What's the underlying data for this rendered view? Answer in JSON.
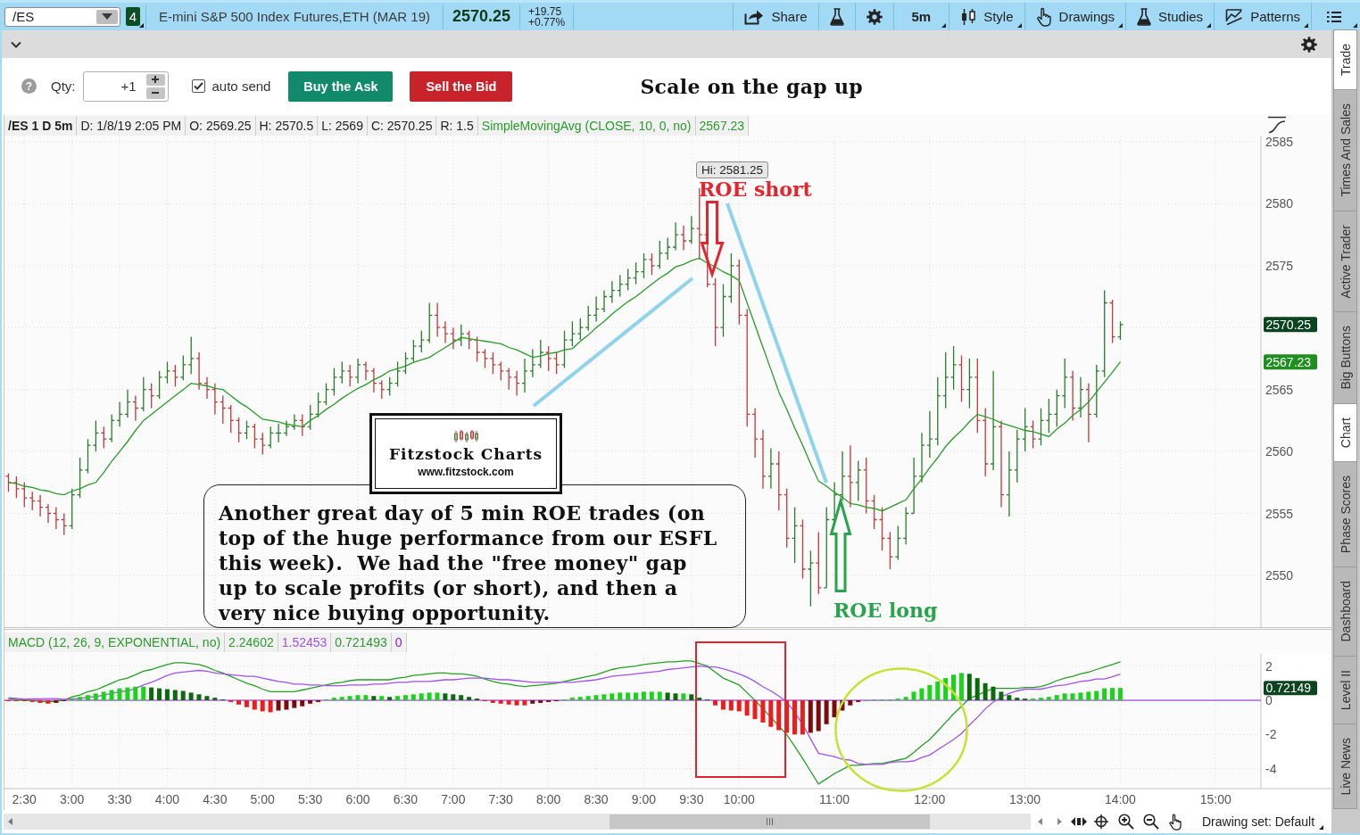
{
  "toolbar": {
    "symbol": "/ES",
    "link_badge": "4",
    "description": "E-mini S&P 500 Index Futures,ETH (MAR 19)",
    "last_price": "2570.25",
    "net_change": "+19.75",
    "percent_change": "+0.77%",
    "buttons": [
      {
        "kind": "share",
        "label": "Share",
        "dropdown": false
      },
      {
        "kind": "flask",
        "dropdown": false
      },
      {
        "kind": "gear",
        "dropdown": false
      },
      {
        "kind": "text",
        "label": "5m",
        "dropdown": true
      },
      {
        "kind": "style",
        "label": "Style",
        "dropdown": true
      },
      {
        "kind": "drawings",
        "label": "Drawings",
        "dropdown": true
      },
      {
        "kind": "studies",
        "label": "Studies",
        "dropdown": true
      },
      {
        "kind": "patterns",
        "label": "Patterns",
        "dropdown": true
      },
      {
        "kind": "menu",
        "dropdown": true
      }
    ]
  },
  "order_bar": {
    "help": "?",
    "qty_label": "Qty:",
    "qty": "+1",
    "auto_send": {
      "label": "auto send",
      "checked": true
    },
    "buttons": [
      {
        "kind": "buy",
        "label": "Buy the Ask"
      },
      {
        "kind": "sell",
        "label": "Sell the Bid"
      }
    ],
    "headline": "Scale on the gap up"
  },
  "price_panel": {
    "header": [
      {
        "kind": "symbol",
        "text": "/ES 1 D 5m"
      },
      {
        "kind": "field",
        "text": "D: 1/8/19 2:05 PM"
      },
      {
        "kind": "field",
        "text": "O: 2569.25"
      },
      {
        "kind": "field",
        "text": "H: 2570.5"
      },
      {
        "kind": "field",
        "text": "L: 2569"
      },
      {
        "kind": "field",
        "text": "C: 2570.25"
      },
      {
        "kind": "field",
        "text": "R: 1.5"
      },
      {
        "kind": "study",
        "text": "SimpleMovingAvg (CLOSE, 10, 0, no)"
      },
      {
        "kind": "study",
        "text": "2567.23"
      }
    ],
    "axis_labels": [
      "2585",
      "2580",
      "2575",
      "2565",
      "2560",
      "2555",
      "2550"
    ],
    "tags": [
      {
        "kind": "close",
        "text": "2570.25",
        "color": "#0c4420"
      },
      {
        "kind": "study",
        "text": "2567.23",
        "color": "#1f8f1f"
      }
    ],
    "drawings": [
      {
        "kind": "callout",
        "text": "Hi: 2581.25"
      },
      {
        "kind": "label",
        "text": "ROE short",
        "color": "#e3262d"
      },
      {
        "kind": "arrow-down",
        "color": "#e3262d"
      },
      {
        "kind": "trendline",
        "color": "#8fd4ec"
      },
      {
        "kind": "trendline",
        "color": "#8fd4ec"
      },
      {
        "kind": "logo",
        "title": "Fitzstock Charts",
        "subtitle": "www.fitzstock.com"
      },
      {
        "kind": "note",
        "text": "Another great day of 5 min ROE trades (on\ntop of the huge performance from our ESFL\nthis week).  We had the \"free money\" gap\nup to scale profits (or short), and then a\nvery nice buying opportunity."
      },
      {
        "kind": "arrow-up",
        "color": "#2aa44c"
      },
      {
        "kind": "label",
        "text": "ROE long",
        "color": "#2aa44c"
      }
    ]
  },
  "macd_panel": {
    "header": [
      {
        "text": "MACD (12, 26, 9, EXPONENTIAL, no)",
        "color": "#2b9b2b"
      },
      {
        "text": "2.24602",
        "color": "#2b9b2b"
      },
      {
        "text": "1.52453",
        "color": "#a352ec"
      },
      {
        "text": "0.721493",
        "color": "#2b9b2b"
      },
      {
        "text": "0",
        "color": "#8a1ccf"
      }
    ],
    "tags": [
      {
        "kind": "diff",
        "text": "0.72149",
        "color": "#0c4420"
      }
    ],
    "chart_data": {
      "type": "line",
      "grid": true,
      "xlim": [
        137.5,
        972.9
      ],
      "ylim": [
        -5.17,
        2.715
      ],
      "yticks": [
        {
          "value": 2,
          "label": "2"
        },
        {
          "value": 0,
          "label": "0"
        },
        {
          "value": -2,
          "label": "-2"
        },
        {
          "value": -4,
          "label": "-4"
        }
      ],
      "xticks": [
        {
          "value": 150,
          "label": "2:30"
        },
        {
          "value": 180,
          "label": "3:00"
        },
        {
          "value": 210,
          "label": "3:30"
        },
        {
          "value": 240,
          "label": "4:00"
        },
        {
          "value": 270,
          "label": "4:30"
        },
        {
          "value": 300,
          "label": "5:00"
        },
        {
          "value": 330,
          "label": "5:30"
        },
        {
          "value": 360,
          "label": "6:00"
        },
        {
          "value": 390,
          "label": "6:30"
        },
        {
          "value": 420,
          "label": "7:00"
        },
        {
          "value": 450,
          "label": "7:30"
        },
        {
          "value": 480,
          "label": "8:00"
        },
        {
          "value": 510,
          "label": "8:30"
        },
        {
          "value": 540,
          "label": "9:00"
        },
        {
          "value": 570,
          "label": "9:30"
        },
        {
          "value": 600,
          "label": "10:00"
        },
        {
          "value": 660,
          "label": "11:00"
        },
        {
          "value": 720,
          "label": "12:00"
        },
        {
          "value": 780,
          "label": "13:00"
        },
        {
          "value": 840,
          "label": "14:00"
        },
        {
          "value": 900,
          "label": "15:00"
        }
      ],
      "ref_lines": [
        {
          "axis": "y",
          "value": 0,
          "color": "#8a1ccf"
        }
      ],
      "x": [
        140,
        145,
        150,
        155,
        160,
        165,
        170,
        175,
        180,
        185,
        190,
        195,
        200,
        205,
        210,
        215,
        220,
        225,
        230,
        235,
        240,
        245,
        250,
        255,
        260,
        265,
        270,
        275,
        280,
        285,
        290,
        295,
        300,
        305,
        310,
        315,
        320,
        325,
        330,
        335,
        340,
        345,
        350,
        355,
        360,
        365,
        370,
        375,
        380,
        385,
        390,
        395,
        400,
        405,
        410,
        415,
        420,
        425,
        430,
        435,
        440,
        445,
        450,
        455,
        460,
        465,
        470,
        475,
        480,
        485,
        490,
        495,
        500,
        505,
        510,
        515,
        520,
        525,
        530,
        535,
        540,
        545,
        550,
        555,
        560,
        565,
        570,
        575,
        580,
        585,
        590,
        595,
        600,
        605,
        610,
        615,
        620,
        625,
        630,
        635,
        640,
        645,
        650,
        655,
        660,
        665,
        670,
        675,
        680,
        685,
        690,
        695,
        700,
        705,
        710,
        715,
        720,
        725,
        730,
        735,
        740,
        745,
        750,
        755,
        760,
        765,
        770,
        775,
        780,
        785,
        790,
        795,
        800,
        805,
        810,
        815,
        820,
        825,
        830,
        835,
        840
      ],
      "series": [
        {
          "color": "#25a025",
          "values": [
            0.1,
            0.06,
            0.02,
            -0.02,
            -0.06,
            -0.1,
            -0.05,
            0,
            0.2,
            0.3,
            0.5,
            0.6,
            0.8,
            1.0,
            1.2,
            1.3,
            1.5,
            1.7,
            1.8,
            1.95,
            2.1,
            2.2,
            2.2,
            2.15,
            2.1,
            1.95,
            1.75,
            1.6,
            1.4,
            1.2,
            1.0,
            0.85,
            0.65,
            0.5,
            0.5,
            0.5,
            0.5,
            0.6,
            0.7,
            0.8,
            0.9,
            1.0,
            1.05,
            1.15,
            1.2,
            1.2,
            1.2,
            1.2,
            1.2,
            1.3,
            1.35,
            1.45,
            1.5,
            1.55,
            1.6,
            1.6,
            1.55,
            1.55,
            1.5,
            1.4,
            1.25,
            1.1,
            1.0,
            0.95,
            0.85,
            0.8,
            0.85,
            0.9,
            0.95,
            1.0,
            1.1,
            1.2,
            1.3,
            1.4,
            1.5,
            1.65,
            1.8,
            1.9,
            1.95,
            2.0,
            2.1,
            2.15,
            2.2,
            2.25,
            2.25,
            2.3,
            2.3,
            2.15,
            2.0,
            1.65,
            1.3,
            1.1,
            0.9,
            0.45,
            0,
            -0.5,
            -1.0,
            -1.5,
            -2.0,
            -2.7,
            -3.4,
            -4.15,
            -4.9,
            -4.6,
            -4.3,
            -4.05,
            -3.8,
            -3.8,
            -3.75,
            -3.7,
            -3.7,
            -3.6,
            -3.5,
            -3.4,
            -3.05,
            -2.65,
            -2.3,
            -1.8,
            -1.3,
            -0.8,
            -0.35,
            0.1,
            0.3,
            0.5,
            0.7,
            0.7,
            0.7,
            0.7,
            0.75,
            0.75,
            0.8,
            0.95,
            1.15,
            1.3,
            1.4,
            1.55,
            1.65,
            1.8,
            1.95,
            2.1,
            2.25
          ]
        },
        {
          "color": "#a352ec",
          "values": [
            0.15,
            0.11,
            0.07,
            0.08,
            0.09,
            0.1,
            0.1,
            0.05,
            0.1,
            0.1,
            0.2,
            0.2,
            0.3,
            0.4,
            0.5,
            0.55,
            0.7,
            0.9,
            1.05,
            1.25,
            1.45,
            1.6,
            1.65,
            1.7,
            1.75,
            1.7,
            1.6,
            1.55,
            1.5,
            1.45,
            1.4,
            1.4,
            1.3,
            1.2,
            1.1,
            1.05,
            0.95,
            0.95,
            0.9,
            0.9,
            0.85,
            0.85,
            0.85,
            0.9,
            0.9,
            0.9,
            0.95,
            0.95,
            1.0,
            1.05,
            1.05,
            1.1,
            1.1,
            1.1,
            1.15,
            1.2,
            1.2,
            1.25,
            1.3,
            1.3,
            1.3,
            1.25,
            1.2,
            1.2,
            1.15,
            1.1,
            1.05,
            1.05,
            1.05,
            1.05,
            1.05,
            1.05,
            1.1,
            1.15,
            1.2,
            1.3,
            1.4,
            1.45,
            1.5,
            1.55,
            1.6,
            1.65,
            1.7,
            1.8,
            1.85,
            1.9,
            1.95,
            2.0,
            1.95,
            1.95,
            1.85,
            1.7,
            1.55,
            1.35,
            1.1,
            0.8,
            0.55,
            0.25,
            -0.1,
            -0.7,
            -1.4,
            -2.25,
            -3.1,
            -3.2,
            -3.3,
            -3.45,
            -3.5,
            -3.7,
            -3.75,
            -3.75,
            -3.75,
            -3.65,
            -3.6,
            -3.6,
            -3.55,
            -3.35,
            -3.2,
            -2.9,
            -2.6,
            -2.3,
            -1.95,
            -1.45,
            -1.0,
            -0.5,
            -0.1,
            0.2,
            0.4,
            0.55,
            0.65,
            0.65,
            0.65,
            0.75,
            0.85,
            0.9,
            1.0,
            1.1,
            1.15,
            1.25,
            1.25,
            1.38,
            1.53
          ]
        },
        {
          "type": "bar",
          "values": [
            -0.05,
            -0.05,
            -0.05,
            -0.1,
            -0.15,
            -0.2,
            -0.15,
            -0.05,
            0.1,
            0.2,
            0.3,
            0.4,
            0.5,
            0.6,
            0.7,
            0.75,
            0.8,
            0.8,
            0.75,
            0.7,
            0.65,
            0.6,
            0.55,
            0.45,
            0.35,
            0.25,
            0.15,
            0.05,
            -0.1,
            -0.25,
            -0.4,
            -0.55,
            -0.65,
            -0.7,
            -0.6,
            -0.55,
            -0.45,
            -0.35,
            -0.2,
            -0.1,
            0.05,
            0.15,
            0.2,
            0.25,
            0.3,
            0.3,
            0.25,
            0.25,
            0.2,
            0.25,
            0.3,
            0.35,
            0.4,
            0.45,
            0.45,
            0.4,
            0.35,
            0.3,
            0.2,
            0.1,
            -0.05,
            -0.15,
            -0.2,
            -0.25,
            -0.3,
            -0.3,
            -0.2,
            -0.15,
            -0.1,
            -0.05,
            0.05,
            0.15,
            0.2,
            0.25,
            0.3,
            0.35,
            0.4,
            0.45,
            0.45,
            0.45,
            0.5,
            0.5,
            0.5,
            0.45,
            0.4,
            0.4,
            0.35,
            0.15,
            0.05,
            -0.3,
            -0.55,
            -0.6,
            -0.65,
            -0.9,
            -1.1,
            -1.3,
            -1.55,
            -1.75,
            -1.9,
            -2.0,
            -2.0,
            -1.9,
            -1.8,
            -1.4,
            -1.0,
            -0.6,
            -0.3,
            -0.1,
            0,
            0.05,
            0.05,
            0.05,
            0.1,
            0.2,
            0.5,
            0.7,
            0.9,
            1.1,
            1.3,
            1.5,
            1.6,
            1.55,
            1.3,
            1.0,
            0.8,
            0.5,
            0.3,
            0.15,
            0.1,
            0.1,
            0.15,
            0.2,
            0.3,
            0.4,
            0.4,
            0.45,
            0.5,
            0.55,
            0.7,
            0.72,
            0.72
          ],
          "colors": [
            "#ee1c1c",
            "#ee1c1c",
            "#ee1c1c",
            "#ee1c1c",
            "#ee1c1c",
            "#ee1c1c",
            "#7c0b0b",
            "#7c0b0b",
            "#19d419",
            "#19d419",
            "#19d419",
            "#19d419",
            "#19d419",
            "#19d419",
            "#19d419",
            "#19d419",
            "#19d419",
            "#19d419",
            "#0b6a0b",
            "#0b6a0b",
            "#0b6a0b",
            "#0b6a0b",
            "#0b6a0b",
            "#0b6a0b",
            "#0b6a0b",
            "#0b6a0b",
            "#0b6a0b",
            "#0b6a0b",
            "#ee1c1c",
            "#ee1c1c",
            "#ee1c1c",
            "#ee1c1c",
            "#ee1c1c",
            "#ee1c1c",
            "#7c0b0b",
            "#7c0b0b",
            "#7c0b0b",
            "#7c0b0b",
            "#7c0b0b",
            "#7c0b0b",
            "#19d419",
            "#19d419",
            "#19d419",
            "#19d419",
            "#19d419",
            "#19d419",
            "#0b6a0b",
            "#19d419",
            "#0b6a0b",
            "#19d419",
            "#19d419",
            "#19d419",
            "#19d419",
            "#19d419",
            "#19d419",
            "#0b6a0b",
            "#0b6a0b",
            "#0b6a0b",
            "#0b6a0b",
            "#0b6a0b",
            "#ee1c1c",
            "#ee1c1c",
            "#ee1c1c",
            "#ee1c1c",
            "#ee1c1c",
            "#ee1c1c",
            "#7c0b0b",
            "#7c0b0b",
            "#7c0b0b",
            "#7c0b0b",
            "#19d419",
            "#19d419",
            "#19d419",
            "#19d419",
            "#19d419",
            "#19d419",
            "#19d419",
            "#19d419",
            "#19d419",
            "#19d419",
            "#19d419",
            "#19d419",
            "#19d419",
            "#0b6a0b",
            "#0b6a0b",
            "#19d419",
            "#0b6a0b",
            "#0b6a0b",
            "#0b6a0b",
            "#ee1c1c",
            "#ee1c1c",
            "#ee1c1c",
            "#ee1c1c",
            "#ee1c1c",
            "#ee1c1c",
            "#ee1c1c",
            "#ee1c1c",
            "#ee1c1c",
            "#ee1c1c",
            "#ee1c1c",
            "#ee1c1c",
            "#7c0b0b",
            "#7c0b0b",
            "#7c0b0b",
            "#7c0b0b",
            "#7c0b0b",
            "#7c0b0b",
            "#7c0b0b",
            "#19d419",
            "#19d419",
            "#19d419",
            "#19d419",
            "#19d419",
            "#19d419",
            "#19d419",
            "#19d419",
            "#19d419",
            "#19d419",
            "#19d419",
            "#19d419",
            "#19d419",
            "#0b6a0b",
            "#0b6a0b",
            "#0b6a0b",
            "#0b6a0b",
            "#0b6a0b",
            "#0b6a0b",
            "#0b6a0b",
            "#0b6a0b",
            "#19d419",
            "#19d419",
            "#19d419",
            "#19d419",
            "#19d419",
            "#19d419",
            "#19d419",
            "#19d419",
            "#19d419",
            "#19d419",
            "#19d419",
            "#19d419"
          ]
        }
      ]
    },
    "drawings": [
      {
        "kind": "rectangle",
        "color": "#e0242b"
      },
      {
        "kind": "ellipse",
        "color": "#c5e234"
      }
    ]
  },
  "footer": {
    "drawing_set": "Drawing set: Default"
  },
  "side_tabs": [
    {
      "label": "Trade",
      "selected": true
    },
    {
      "label": "Times And Sales",
      "selected": false
    },
    {
      "label": "Active Trader",
      "selected": false
    },
    {
      "label": "Big Buttons",
      "selected": false
    },
    {
      "label": "Chart",
      "selected": true
    },
    {
      "label": "Phase Scores",
      "selected": false
    },
    {
      "label": "Dashboard",
      "selected": false
    },
    {
      "label": "Level II",
      "selected": false
    },
    {
      "label": "Live News",
      "selected": false
    }
  ]
}
